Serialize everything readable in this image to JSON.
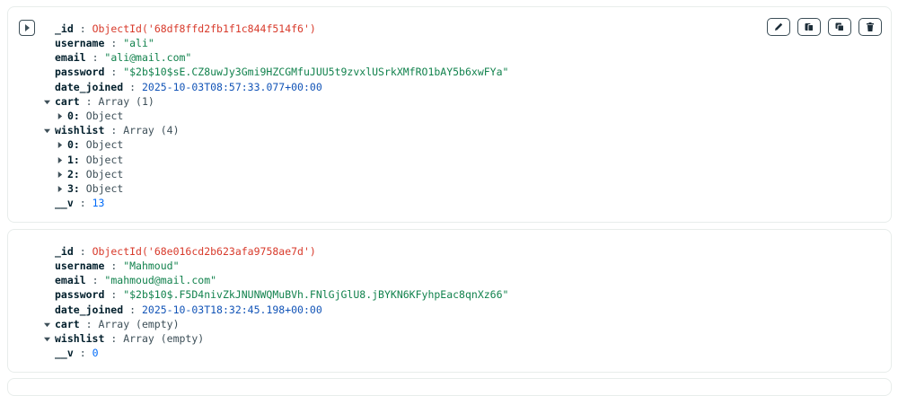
{
  "documents": [
    {
      "id": "ObjectId('68df8ffd2fb1f1c844f514f6')",
      "username": "\"ali\"",
      "email": "\"ali@mail.com\"",
      "password": "\"$2b$10$sE.CZ8uwJy3Gmi9HZCGMfuJUU5t9zvxlUSrkXMfRO1bAY5b6xwFYa\"",
      "date_joined": "2025-10-03T08:57:33.077+00:00",
      "cart_summary": "Array (1)",
      "cart_items": [
        {
          "index": "0:",
          "type": "Object"
        }
      ],
      "wishlist_summary": "Array (4)",
      "wishlist_items": [
        {
          "index": "0:",
          "type": "Object"
        },
        {
          "index": "1:",
          "type": "Object"
        },
        {
          "index": "2:",
          "type": "Object"
        },
        {
          "index": "3:",
          "type": "Object"
        }
      ],
      "v": "13"
    },
    {
      "id": "ObjectId('68e016cd2b623afa9758ae7d')",
      "username": "\"Mahmoud\"",
      "email": "\"mahmoud@mail.com\"",
      "password": "\"$2b$10$.F5D4nivZkJNUNWQMuBVh.FNlGjGlU8.jBYKN6KFyhpEac8qnXz66\"",
      "date_joined": "2025-10-03T18:32:45.198+00:00",
      "cart_summary": "Array (empty)",
      "wishlist_summary": "Array (empty)",
      "v": "0"
    }
  ],
  "labels": {
    "id": "_id",
    "username": "username",
    "email": "email",
    "password": "password",
    "date_joined": "date_joined",
    "cart": "cart",
    "wishlist": "wishlist",
    "v": "__v",
    "separator": ":"
  },
  "icons": {
    "expand": "caret-right-icon",
    "edit": "pencil-icon",
    "copy": "copy-icon",
    "clone": "clone-icon",
    "delete": "trash-icon"
  },
  "colors": {
    "objectid": "#d83a2b",
    "string": "#12824d",
    "date": "#1254b7",
    "number": "#016bf8"
  }
}
